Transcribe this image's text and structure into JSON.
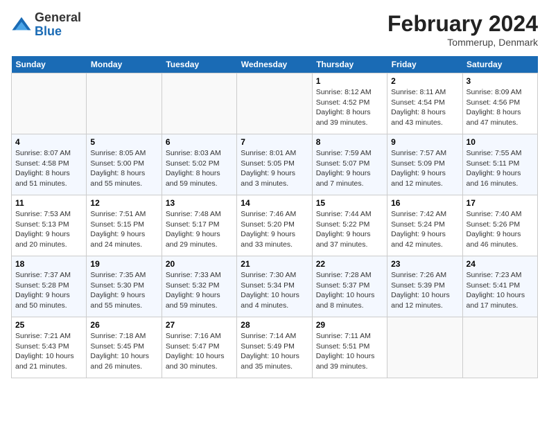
{
  "logo": {
    "general": "General",
    "blue": "Blue"
  },
  "title": "February 2024",
  "subtitle": "Tommerup, Denmark",
  "days_of_week": [
    "Sunday",
    "Monday",
    "Tuesday",
    "Wednesday",
    "Thursday",
    "Friday",
    "Saturday"
  ],
  "weeks": [
    [
      {
        "day": "",
        "sunrise": "",
        "sunset": "",
        "daylight": ""
      },
      {
        "day": "",
        "sunrise": "",
        "sunset": "",
        "daylight": ""
      },
      {
        "day": "",
        "sunrise": "",
        "sunset": "",
        "daylight": ""
      },
      {
        "day": "",
        "sunrise": "",
        "sunset": "",
        "daylight": ""
      },
      {
        "day": "1",
        "sunrise": "Sunrise: 8:12 AM",
        "sunset": "Sunset: 4:52 PM",
        "daylight": "Daylight: 8 hours and 39 minutes."
      },
      {
        "day": "2",
        "sunrise": "Sunrise: 8:11 AM",
        "sunset": "Sunset: 4:54 PM",
        "daylight": "Daylight: 8 hours and 43 minutes."
      },
      {
        "day": "3",
        "sunrise": "Sunrise: 8:09 AM",
        "sunset": "Sunset: 4:56 PM",
        "daylight": "Daylight: 8 hours and 47 minutes."
      }
    ],
    [
      {
        "day": "4",
        "sunrise": "Sunrise: 8:07 AM",
        "sunset": "Sunset: 4:58 PM",
        "daylight": "Daylight: 8 hours and 51 minutes."
      },
      {
        "day": "5",
        "sunrise": "Sunrise: 8:05 AM",
        "sunset": "Sunset: 5:00 PM",
        "daylight": "Daylight: 8 hours and 55 minutes."
      },
      {
        "day": "6",
        "sunrise": "Sunrise: 8:03 AM",
        "sunset": "Sunset: 5:02 PM",
        "daylight": "Daylight: 8 hours and 59 minutes."
      },
      {
        "day": "7",
        "sunrise": "Sunrise: 8:01 AM",
        "sunset": "Sunset: 5:05 PM",
        "daylight": "Daylight: 9 hours and 3 minutes."
      },
      {
        "day": "8",
        "sunrise": "Sunrise: 7:59 AM",
        "sunset": "Sunset: 5:07 PM",
        "daylight": "Daylight: 9 hours and 7 minutes."
      },
      {
        "day": "9",
        "sunrise": "Sunrise: 7:57 AM",
        "sunset": "Sunset: 5:09 PM",
        "daylight": "Daylight: 9 hours and 12 minutes."
      },
      {
        "day": "10",
        "sunrise": "Sunrise: 7:55 AM",
        "sunset": "Sunset: 5:11 PM",
        "daylight": "Daylight: 9 hours and 16 minutes."
      }
    ],
    [
      {
        "day": "11",
        "sunrise": "Sunrise: 7:53 AM",
        "sunset": "Sunset: 5:13 PM",
        "daylight": "Daylight: 9 hours and 20 minutes."
      },
      {
        "day": "12",
        "sunrise": "Sunrise: 7:51 AM",
        "sunset": "Sunset: 5:15 PM",
        "daylight": "Daylight: 9 hours and 24 minutes."
      },
      {
        "day": "13",
        "sunrise": "Sunrise: 7:48 AM",
        "sunset": "Sunset: 5:17 PM",
        "daylight": "Daylight: 9 hours and 29 minutes."
      },
      {
        "day": "14",
        "sunrise": "Sunrise: 7:46 AM",
        "sunset": "Sunset: 5:20 PM",
        "daylight": "Daylight: 9 hours and 33 minutes."
      },
      {
        "day": "15",
        "sunrise": "Sunrise: 7:44 AM",
        "sunset": "Sunset: 5:22 PM",
        "daylight": "Daylight: 9 hours and 37 minutes."
      },
      {
        "day": "16",
        "sunrise": "Sunrise: 7:42 AM",
        "sunset": "Sunset: 5:24 PM",
        "daylight": "Daylight: 9 hours and 42 minutes."
      },
      {
        "day": "17",
        "sunrise": "Sunrise: 7:40 AM",
        "sunset": "Sunset: 5:26 PM",
        "daylight": "Daylight: 9 hours and 46 minutes."
      }
    ],
    [
      {
        "day": "18",
        "sunrise": "Sunrise: 7:37 AM",
        "sunset": "Sunset: 5:28 PM",
        "daylight": "Daylight: 9 hours and 50 minutes."
      },
      {
        "day": "19",
        "sunrise": "Sunrise: 7:35 AM",
        "sunset": "Sunset: 5:30 PM",
        "daylight": "Daylight: 9 hours and 55 minutes."
      },
      {
        "day": "20",
        "sunrise": "Sunrise: 7:33 AM",
        "sunset": "Sunset: 5:32 PM",
        "daylight": "Daylight: 9 hours and 59 minutes."
      },
      {
        "day": "21",
        "sunrise": "Sunrise: 7:30 AM",
        "sunset": "Sunset: 5:34 PM",
        "daylight": "Daylight: 10 hours and 4 minutes."
      },
      {
        "day": "22",
        "sunrise": "Sunrise: 7:28 AM",
        "sunset": "Sunset: 5:37 PM",
        "daylight": "Daylight: 10 hours and 8 minutes."
      },
      {
        "day": "23",
        "sunrise": "Sunrise: 7:26 AM",
        "sunset": "Sunset: 5:39 PM",
        "daylight": "Daylight: 10 hours and 12 minutes."
      },
      {
        "day": "24",
        "sunrise": "Sunrise: 7:23 AM",
        "sunset": "Sunset: 5:41 PM",
        "daylight": "Daylight: 10 hours and 17 minutes."
      }
    ],
    [
      {
        "day": "25",
        "sunrise": "Sunrise: 7:21 AM",
        "sunset": "Sunset: 5:43 PM",
        "daylight": "Daylight: 10 hours and 21 minutes."
      },
      {
        "day": "26",
        "sunrise": "Sunrise: 7:18 AM",
        "sunset": "Sunset: 5:45 PM",
        "daylight": "Daylight: 10 hours and 26 minutes."
      },
      {
        "day": "27",
        "sunrise": "Sunrise: 7:16 AM",
        "sunset": "Sunset: 5:47 PM",
        "daylight": "Daylight: 10 hours and 30 minutes."
      },
      {
        "day": "28",
        "sunrise": "Sunrise: 7:14 AM",
        "sunset": "Sunset: 5:49 PM",
        "daylight": "Daylight: 10 hours and 35 minutes."
      },
      {
        "day": "29",
        "sunrise": "Sunrise: 7:11 AM",
        "sunset": "Sunset: 5:51 PM",
        "daylight": "Daylight: 10 hours and 39 minutes."
      },
      {
        "day": "",
        "sunrise": "",
        "sunset": "",
        "daylight": ""
      },
      {
        "day": "",
        "sunrise": "",
        "sunset": "",
        "daylight": ""
      }
    ]
  ]
}
